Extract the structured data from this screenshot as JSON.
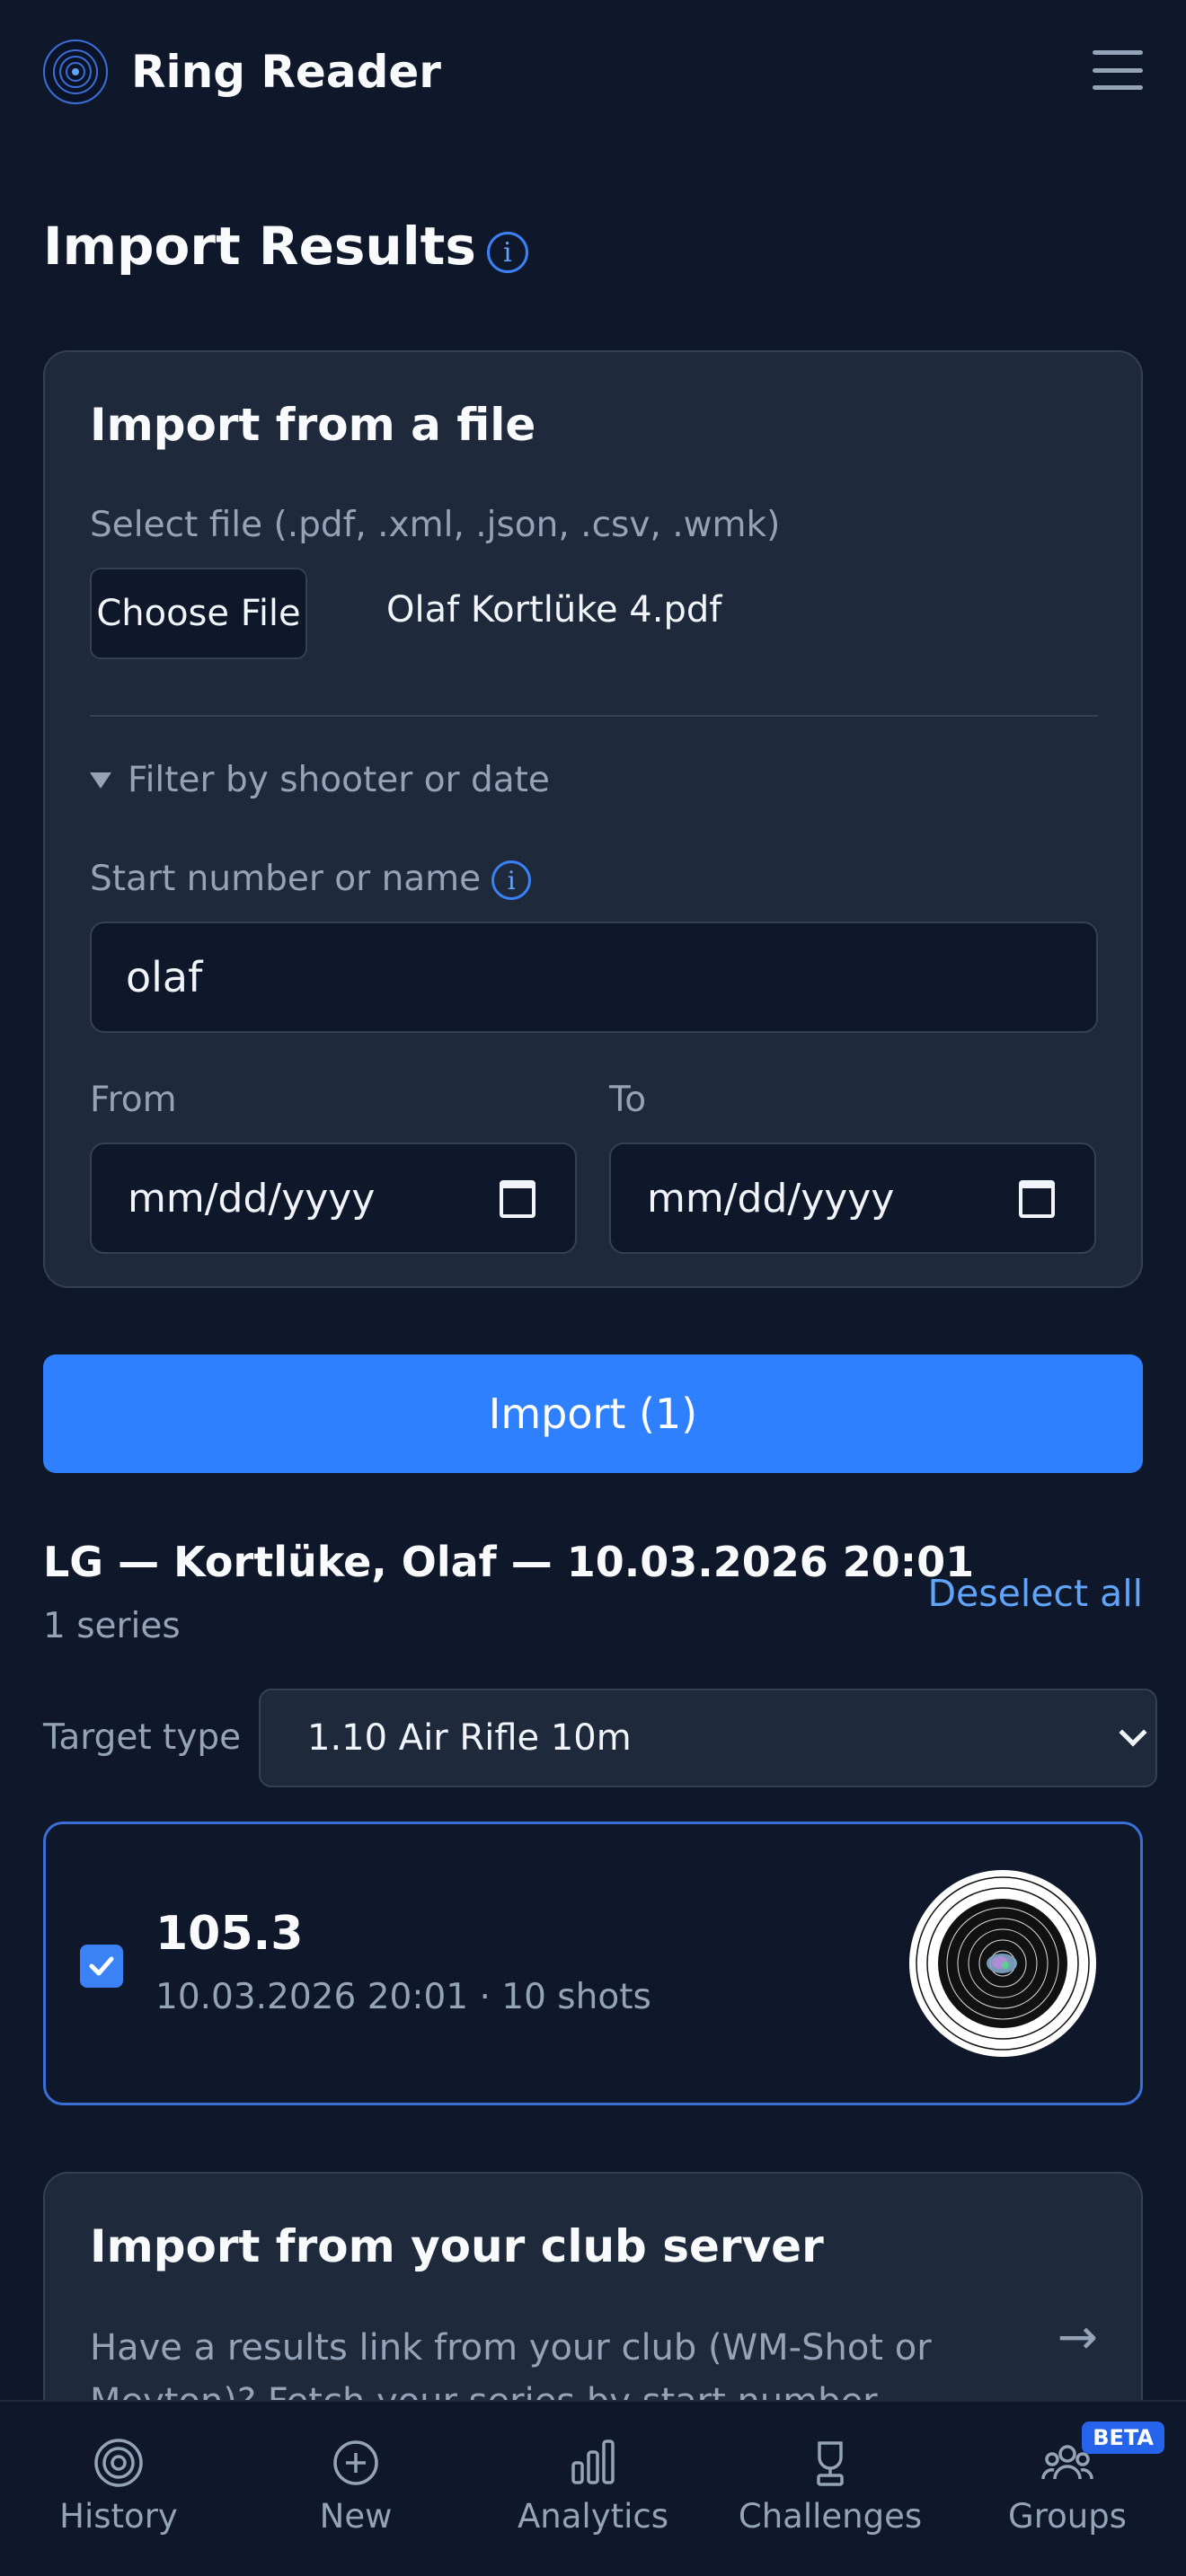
{
  "header": {
    "app_title": "Ring Reader",
    "logo_icon": "target-logo-icon",
    "menu_icon": "hamburger-menu-icon"
  },
  "page": {
    "title": "Import Results",
    "info_icon_glyph": "i"
  },
  "file_import": {
    "title": "Import from a file",
    "file_label": "Select file (.pdf, .xml, .json, .csv, .wmk)",
    "choose_button": "Choose File",
    "file_name": "Olaf Kortlüke 4.pdf",
    "filter_toggle": "Filter by shooter or date",
    "start_label": "Start number or name",
    "start_value": "olaf",
    "from_label": "From",
    "to_label": "To",
    "from_placeholder": "mm/dd/yyyy",
    "to_placeholder": "mm/dd/yyyy"
  },
  "import_button": "Import (1)",
  "result": {
    "heading": "LG — Kortlüke, Olaf — 10.03.2026 20:01",
    "series_count": "1 series",
    "deselect_all": "Deselect all",
    "target_type_label": "Target type",
    "target_type_value": "1.10 Air Rifle 10m",
    "series": [
      {
        "score": "105.3",
        "meta": "10.03.2026 20:01 · 10 shots",
        "checked": true
      }
    ]
  },
  "club_import": {
    "title": "Import from your club server",
    "description": "Have a results link from your club (WM-Shot or Meyton)? Fetch your series by start number."
  },
  "bottom_nav": {
    "items": [
      {
        "label": "History",
        "icon": "target-history-icon"
      },
      {
        "label": "New",
        "icon": "plus-circle-icon"
      },
      {
        "label": "Analytics",
        "icon": "bar-chart-icon"
      },
      {
        "label": "Challenges",
        "icon": "trophy-icon"
      },
      {
        "label": "Groups",
        "icon": "group-icon"
      }
    ],
    "beta_badge": "BETA"
  },
  "colors": {
    "background": "#0f172a",
    "card": "#1e293b",
    "accent": "#2f80ff",
    "link": "#60a5fa"
  }
}
